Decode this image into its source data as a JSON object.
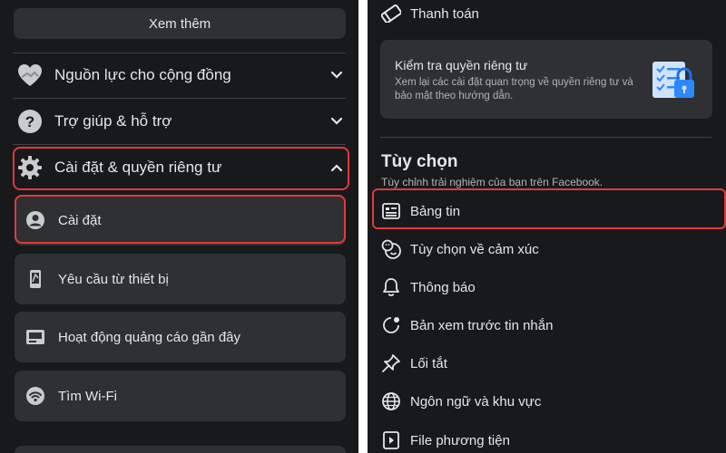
{
  "left": {
    "see_more": "Xem thêm",
    "sections": [
      {
        "label": "Nguồn lực cho cộng đồng",
        "icon": "heart-hands-icon",
        "expanded": false
      },
      {
        "label": "Trợ giúp & hỗ trợ",
        "icon": "question-icon",
        "expanded": false
      },
      {
        "label": "Cài đặt & quyền riêng tư",
        "icon": "gear-icon",
        "expanded": true
      }
    ],
    "sub_items": [
      {
        "label": "Cài đặt",
        "icon": "user-circle-icon"
      },
      {
        "label": "Yêu cầu từ thiết bị",
        "icon": "phone-icon"
      },
      {
        "label": "Hoạt động quảng cáo gần đây",
        "icon": "ad-icon"
      },
      {
        "label": "Tìm Wi-Fi",
        "icon": "wifi-icon"
      }
    ]
  },
  "right": {
    "payment": "Thanh toán",
    "privacy_check": {
      "title": "Kiểm tra quyền riêng tư",
      "description": "Xem lại các cài đặt quan trọng về quyền riêng tư và bảo mật theo hướng dẫn."
    },
    "preferences": {
      "title": "Tùy chọn",
      "subtitle": "Tùy chỉnh trải nghiệm của bạn trên Facebook.",
      "items": [
        {
          "label": "Bảng tin",
          "icon": "news-feed-icon"
        },
        {
          "label": "Tùy chọn về cảm xúc",
          "icon": "reactions-icon"
        },
        {
          "label": "Thông báo",
          "icon": "bell-icon"
        },
        {
          "label": "Bản xem trước tin nhắn",
          "icon": "message-preview-icon"
        },
        {
          "label": "Lối tắt",
          "icon": "pin-icon"
        },
        {
          "label": "Ngôn ngữ và khu vực",
          "icon": "globe-icon"
        },
        {
          "label": "File phương tiện",
          "icon": "media-file-icon"
        }
      ]
    }
  },
  "colors": {
    "background": "#18191a",
    "card": "#2f3031",
    "text": "#e4e6eb",
    "secondary_text": "#b0b3b8",
    "highlight": "#e03a3e",
    "accent_blue": "#2d88ff"
  }
}
